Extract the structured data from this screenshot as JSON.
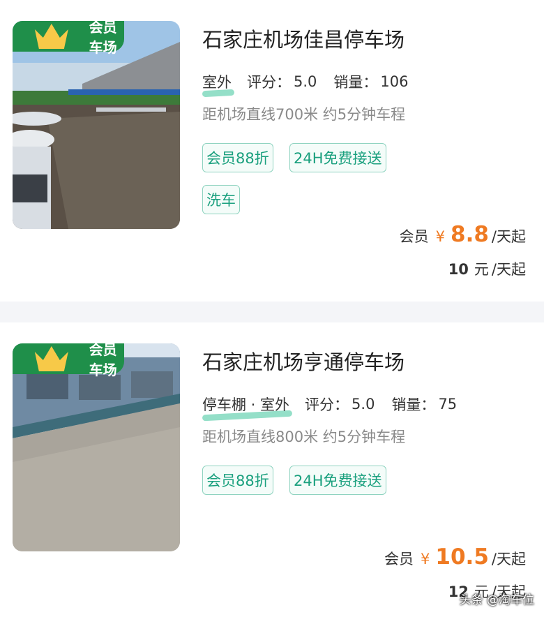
{
  "listings": [
    {
      "badge": "会员车场",
      "name": "石家庄机场佳昌停车场",
      "parking_type": "室外",
      "rating_label": "评分：",
      "rating": "5.0",
      "sales_label": "销量：",
      "sales": "106",
      "distance": "距机场直线700米 约5分钟车程",
      "tags": [
        "会员88折",
        "24H免费接送",
        "洗车"
      ],
      "price": {
        "label": "会员",
        "currency": "¥",
        "value": "8.8",
        "unit": "/天起"
      },
      "original": {
        "value": "10",
        "currency": "元",
        "unit": "/天起"
      }
    },
    {
      "badge": "会员车场",
      "name": "石家庄机场亨通停车场",
      "parking_type": "停车棚 · 室外",
      "rating_label": "评分：",
      "rating": "5.0",
      "sales_label": "销量：",
      "sales": "75",
      "distance": "距机场直线800米 约5分钟车程",
      "tags": [
        "会员88折",
        "24H免费接送"
      ],
      "price": {
        "label": "会员",
        "currency": "¥",
        "value": "10.5",
        "unit": "/天起"
      },
      "original": {
        "value": "12",
        "currency": "元",
        "unit": "/天起"
      }
    }
  ],
  "watermark": "头条 @淘车位",
  "colors": {
    "accent": "#ef7a22",
    "tag_green": "#1aa07e",
    "badge_green": "#1f8f4a"
  }
}
